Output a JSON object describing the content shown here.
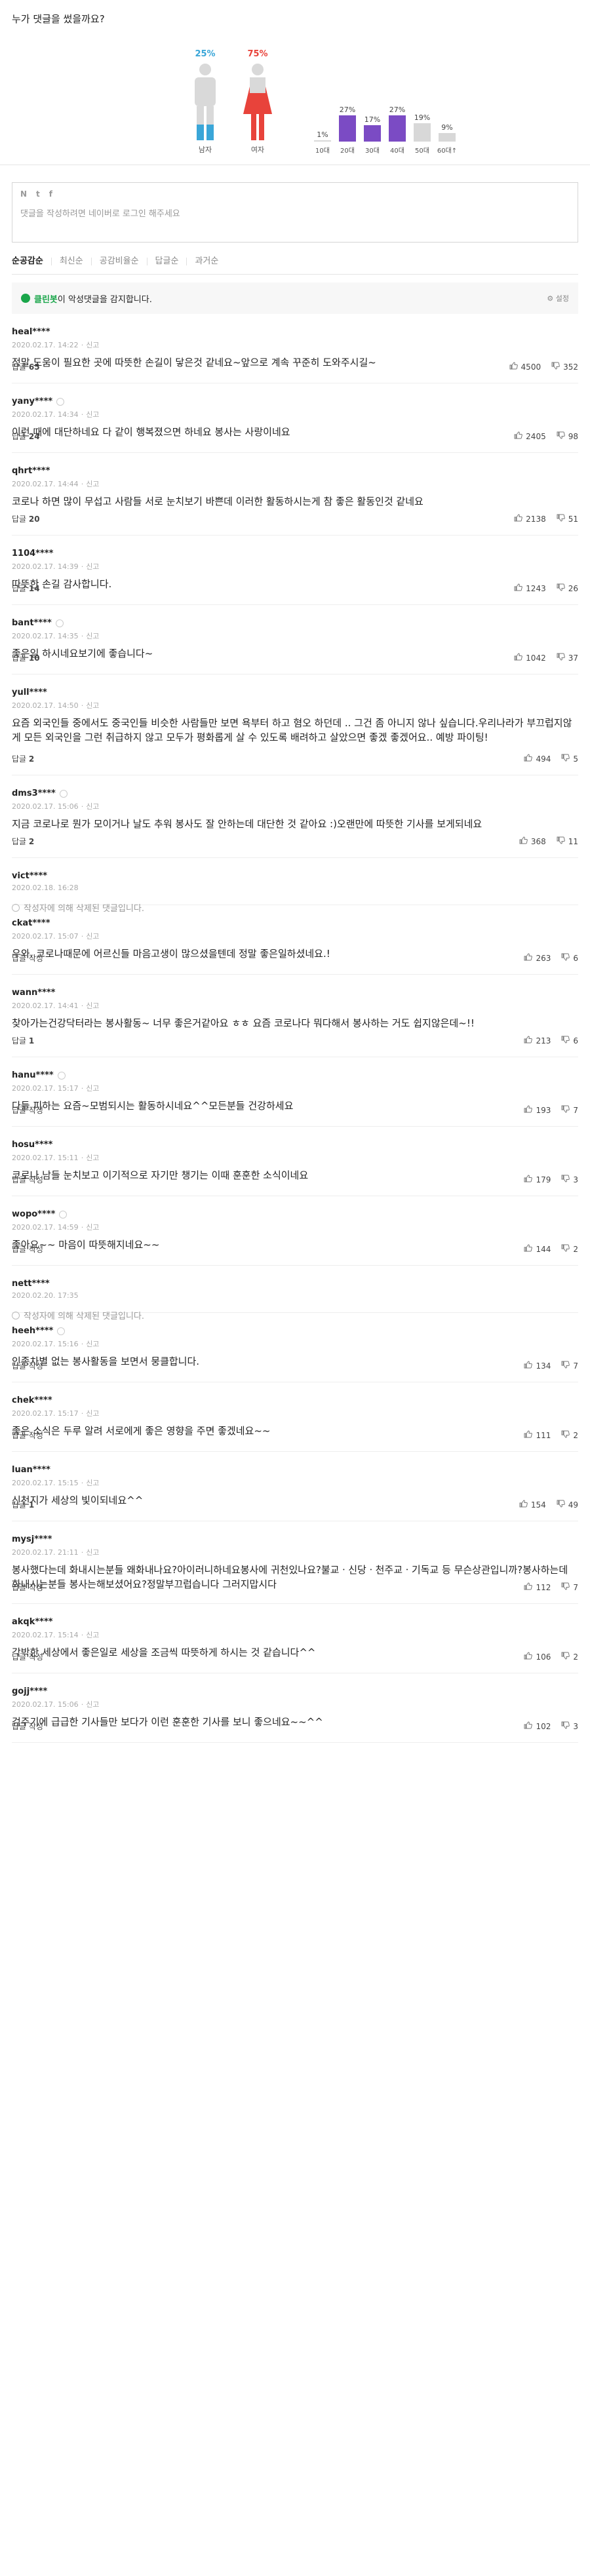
{
  "demographics": {
    "title": "누가 댓글을 썼을까요?",
    "male": {
      "label": "남자",
      "percent": "25%",
      "color": "#3aa6d8"
    },
    "female": {
      "label": "여자",
      "percent": "75%",
      "color": "#e8433b"
    },
    "ages": [
      {
        "label": "10대",
        "percent": "1%",
        "value": 1
      },
      {
        "label": "20대",
        "percent": "27%",
        "value": 27
      },
      {
        "label": "30대",
        "percent": "17%",
        "value": 17
      },
      {
        "label": "40대",
        "percent": "27%",
        "value": 27
      },
      {
        "label": "50대",
        "percent": "19%",
        "value": 19
      },
      {
        "label": "60대↑",
        "percent": "9%",
        "value": 9
      }
    ],
    "highlight_color": "#7b4bc4",
    "bar_color": "#d8d8d8"
  },
  "write_box": {
    "sns_icons": [
      "N",
      "t",
      "f"
    ],
    "placeholder": "댓글을 작성하려면 네이버로 로그인 해주세요"
  },
  "sort_tabs": [
    "순공감순",
    "최신순",
    "공감비율순",
    "답글순",
    "과거순"
  ],
  "cleanbot": {
    "name": "클린봇",
    "text": "이 악성댓글을 감지합니다.",
    "settings": "설정"
  },
  "reply_label": "답글",
  "reply_write_label": "답글 작성",
  "report_label": "신고",
  "comments": [
    {
      "nick": "heal****",
      "date": "2020.02.17. 14:22",
      "report": true,
      "text": "정말 도움이 필요한 곳에 따뜻한 손길이 닿은것 같네요~앞으로 계속 꾸준히 도와주시길~",
      "replies": "65",
      "likes": "4500",
      "dislikes": "352",
      "icon": false
    },
    {
      "nick": "yany****",
      "date": "2020.02.17. 14:34",
      "report": true,
      "text": "이런 때에 대단하네요 다 같이 행복졌으면 하네요 봉사는 사랑이네요",
      "replies": "24",
      "likes": "2405",
      "dislikes": "98",
      "icon": true
    },
    {
      "nick": "qhrt****",
      "date": "2020.02.17. 14:44",
      "report": true,
      "text": "코로나 하면 많이 무섭고 사람들 서로 눈치보기 바쁜데 이러한 활동하시는게 참 좋은 활동인것 같네요",
      "replies": "20",
      "likes": "2138",
      "dislikes": "51",
      "icon": false
    },
    {
      "nick": "1104****",
      "date": "2020.02.17. 14:39",
      "report": true,
      "text": "따뜻한 손길 감사합니다.",
      "replies": "14",
      "likes": "1243",
      "dislikes": "26",
      "icon": false
    },
    {
      "nick": "bant****",
      "date": "2020.02.17. 14:35",
      "report": true,
      "text": "좋은일 하시네요보기에 좋습니다~",
      "replies": "10",
      "likes": "1042",
      "dislikes": "37",
      "icon": true
    },
    {
      "nick": "yull****",
      "date": "2020.02.17. 14:50",
      "report": true,
      "text": "요즘 외국인들 중에서도 중국인들 비슷한 사람들만 보면 욕부터 하고 혐오 하던데 .. 그건 좀 아니지 않나 싶습니다.우리나라가 부끄럽지않게 모든 외국인을 그런 취급하지 않고 모두가 평화롭게 살 수 있도록 배려하고 살았으면 좋겠 좋겠어요.. 예방 파이팅!",
      "replies": "2",
      "likes": "494",
      "dislikes": "5",
      "icon": false
    },
    {
      "nick": "dms3****",
      "date": "2020.02.17. 15:06",
      "report": true,
      "text": "지금 코로나로 뭔가 모이거나 날도 추워 봉사도 잘 안하는데 대단한 것 같아요 :)오랜만에 따뜻한 기사를 보게되네요",
      "replies": "2",
      "likes": "368",
      "dislikes": "11",
      "icon": true
    },
    {
      "nick": "vict****",
      "date": "2020.02.18. 16:28",
      "report": false,
      "deleted": true,
      "text": "작성자에 의해 삭제된 댓글입니다.",
      "icon": false
    },
    {
      "nick": "ckat****",
      "date": "2020.02.17. 15:07",
      "report": true,
      "text": "우와. 코로나때문에 어르신들 마음고생이 많으셨을텐데 정말 좋은일하셨네요.!",
      "replies": "",
      "likes": "263",
      "dislikes": "6",
      "icon": false
    },
    {
      "nick": "wann****",
      "date": "2020.02.17. 14:41",
      "report": true,
      "text": "찾아가는건강닥터라는 봉사활동~ 너무 좋은거같아요 ㅎㅎ 요즘 코로나다 뭐다해서 봉사하는 거도 쉽지않은데~!!",
      "replies": "1",
      "likes": "213",
      "dislikes": "6",
      "icon": false
    },
    {
      "nick": "hanu****",
      "date": "2020.02.17. 15:17",
      "report": true,
      "text": "다들 피하는 요즘~모범되시는 활동하시네요^^모든분들 건강하세요",
      "replies": "",
      "likes": "193",
      "dislikes": "7",
      "icon": true
    },
    {
      "nick": "hosu****",
      "date": "2020.02.17. 15:11",
      "report": true,
      "text": "코로나 남들 눈치보고 이기적으로 자기만 챙기는 이때 훈훈한 소식이네요",
      "replies": "",
      "likes": "179",
      "dislikes": "3",
      "icon": false
    },
    {
      "nick": "wopo****",
      "date": "2020.02.17. 14:59",
      "report": true,
      "text": "좋아요~~ 마음이 따뜻해지네요~~",
      "replies": "",
      "likes": "144",
      "dislikes": "2",
      "icon": true
    },
    {
      "nick": "nett****",
      "date": "2020.02.20. 17:35",
      "report": false,
      "deleted": true,
      "text": "작성자에 의해 삭제된 댓글입니다.",
      "icon": false
    },
    {
      "nick": "heeh****",
      "date": "2020.02.17. 15:16",
      "report": true,
      "text": "인종차별 없는 봉사활동을 보면서 뭉클합니다.",
      "replies": "",
      "likes": "134",
      "dislikes": "7",
      "icon": true
    },
    {
      "nick": "chek****",
      "date": "2020.02.17. 15:17",
      "report": true,
      "text": "좋은 소식은 두루 알려 서로에게 좋은 영향을 주면 좋겠네요~~",
      "replies": "",
      "likes": "111",
      "dislikes": "2",
      "icon": false
    },
    {
      "nick": "luan****",
      "date": "2020.02.17. 15:15",
      "report": true,
      "text": "신천지가 세상의 빛이되네요^^",
      "replies": "1",
      "likes": "154",
      "dislikes": "49",
      "icon": false
    },
    {
      "nick": "mysj****",
      "date": "2020.02.17. 21:11",
      "report": true,
      "text": "봉사했다는데 화내시는분들 왜화내나요?아이러니하네요봉사에 귀천있나요?불교ㆍ신당ㆍ천주교ㆍ기독교 등 무슨상관입니까?봉사하는데 화내시는분들 봉사는해보셨어요?정말부끄럽습니다 그러지맙시다",
      "replies": "",
      "likes": "112",
      "dislikes": "7",
      "icon": false
    },
    {
      "nick": "akqk****",
      "date": "2020.02.17. 15:14",
      "report": true,
      "text": "각박한 세상에서 좋은일로 세상을 조금씩 따뜻하게 하시는 것 같습니다^^",
      "replies": "",
      "likes": "106",
      "dislikes": "2",
      "icon": false
    },
    {
      "nick": "gojj****",
      "date": "2020.02.17. 15:06",
      "report": true,
      "text": "검주기에 급급한 기사들만 보다가 이런 훈훈한 기사를 보니 좋으네요~~^^",
      "replies": "",
      "likes": "102",
      "dislikes": "3",
      "icon": false
    }
  ]
}
